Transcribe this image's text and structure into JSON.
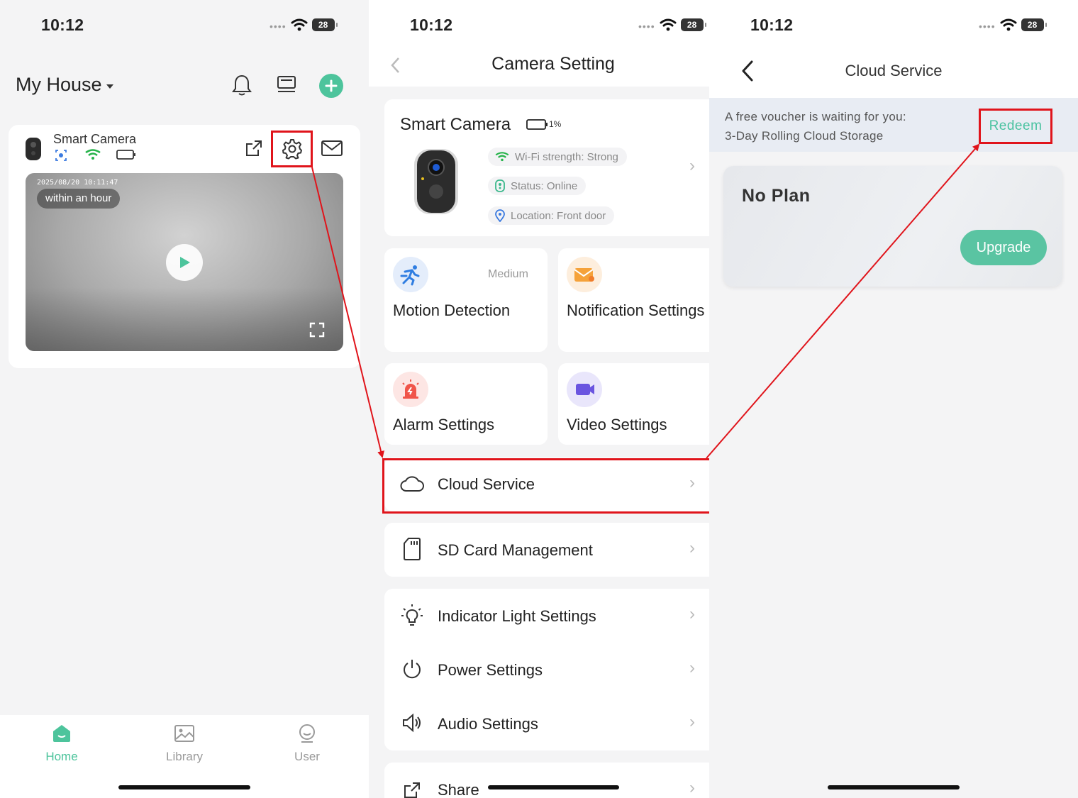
{
  "screens": [
    {
      "status": {
        "time": "10:12",
        "battery": "28"
      },
      "home": {
        "house_title": "My House",
        "camera": {
          "name": "Smart Camera",
          "timestamp": "2025/08/20 10:11:47",
          "recency": "within an hour"
        },
        "tabs": [
          {
            "label": "Home",
            "active": true
          },
          {
            "label": "Library",
            "active": false
          },
          {
            "label": "User",
            "active": false
          }
        ]
      }
    },
    {
      "status": {
        "time": "10:12",
        "battery": "28"
      },
      "camera_setting": {
        "title": "Camera Setting",
        "device": {
          "name": "Smart Camera",
          "battery_label": "1%",
          "wifi": "Wi-Fi strength: Strong",
          "status": "Status: Online",
          "location": "Location: Front door"
        },
        "tiles": [
          {
            "label": "Motion Detection",
            "value": "Medium"
          },
          {
            "label": "Notification Settings",
            "value": ""
          },
          {
            "label": "Alarm Settings",
            "value": ""
          },
          {
            "label": "Video Settings",
            "value": ""
          }
        ],
        "rows": [
          {
            "label": "Cloud Service"
          },
          {
            "label": "SD Card Management"
          },
          {
            "label": "Indicator Light Settings"
          },
          {
            "label": "Power Settings"
          },
          {
            "label": "Audio Settings"
          },
          {
            "label": "Share"
          }
        ]
      }
    },
    {
      "status": {
        "time": "10:12",
        "battery": "28"
      },
      "cloud_service": {
        "title": "Cloud Service",
        "voucher_line1": "A free voucher is waiting for you:",
        "voucher_line2": "3-Day Rolling Cloud Storage",
        "redeem_label": "Redeem",
        "plan_title": "No Plan",
        "upgrade_label": "Upgrade"
      }
    }
  ],
  "colors": {
    "accent": "#4dc49c",
    "highlight": "#e0141b"
  }
}
